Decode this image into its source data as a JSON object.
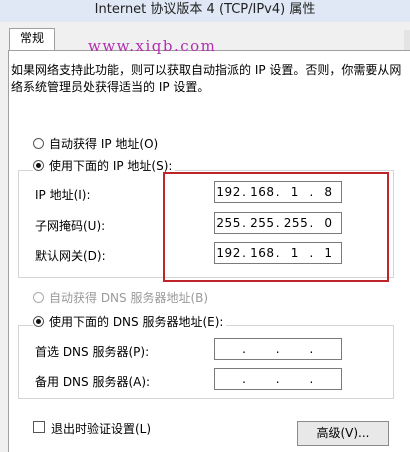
{
  "window": {
    "title": "Internet 协议版本 4 (TCP/IPv4) 属性"
  },
  "tabs": [
    {
      "label": "常规"
    }
  ],
  "watermark": "www.xiqb.com",
  "description": "如果网络支持此功能，则可以获取自动指派的 IP 设置。否则，你需要从网络系统管理员处获得适当的 IP 设置。",
  "ip_settings": {
    "auto_option": "自动获得 IP 地址(O)",
    "manual_option": "使用下面的 IP 地址(S):",
    "selected": "manual",
    "fields": [
      {
        "label": "IP 地址(I):",
        "octets": [
          "192",
          "168",
          "1",
          "8"
        ]
      },
      {
        "label": "子网掩码(U):",
        "octets": [
          "255",
          "255",
          "255",
          "0"
        ]
      },
      {
        "label": "默认网关(D):",
        "octets": [
          "192",
          "168",
          "1",
          "1"
        ]
      }
    ]
  },
  "dns_settings": {
    "auto_option": "自动获得 DNS 服务器地址(B)",
    "auto_disabled": true,
    "manual_option": "使用下面的 DNS 服务器地址(E):",
    "selected": "manual",
    "fields": [
      {
        "label": "首选 DNS 服务器(P):",
        "octets": [
          "",
          "",
          "",
          ""
        ]
      },
      {
        "label": "备用 DNS 服务器(A):",
        "octets": [
          "",
          "",
          "",
          ""
        ]
      }
    ]
  },
  "validate_on_exit": {
    "label": "退出时验证设置(L)",
    "checked": false
  },
  "advanced_button": "高级(V)...",
  "highlight_color": "#c0242b",
  "watermark_color": "#b12fb1"
}
